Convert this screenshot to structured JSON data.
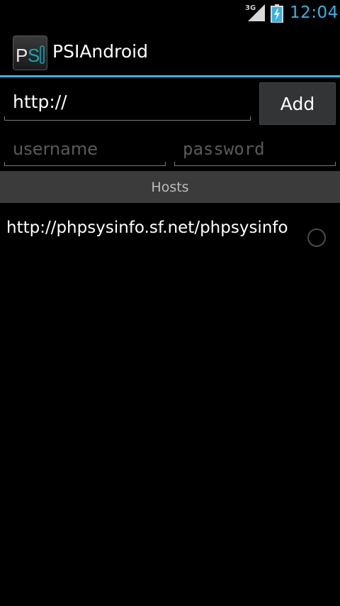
{
  "status_bar": {
    "network_type": "3G",
    "signal_icon": "signal-icon",
    "battery_icon": "battery-charging-icon",
    "time": "12:04",
    "accent_color": "#33b5e5"
  },
  "action_bar": {
    "app_icon": "psi-app-icon",
    "app_icon_text_p": "P",
    "app_icon_text_s": "S",
    "app_icon_text_i": "I",
    "title": "PSIAndroid",
    "divider_color": "#33b5e5"
  },
  "form": {
    "url_value": "http://",
    "add_label": "Add",
    "username_placeholder": "username",
    "password_placeholder": "password"
  },
  "hosts": {
    "header": "Hosts",
    "items": [
      {
        "url": "http://phpsysinfo.sf.net/phpsysinfo",
        "selected": false
      }
    ]
  }
}
